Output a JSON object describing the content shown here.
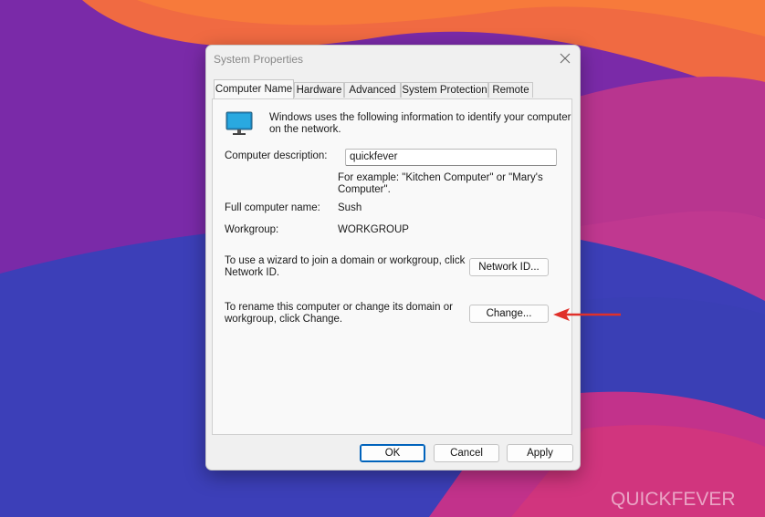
{
  "dialog": {
    "title": "System Properties",
    "tabs": [
      {
        "label": "Computer Name",
        "active": true
      },
      {
        "label": "Hardware",
        "active": false
      },
      {
        "label": "Advanced",
        "active": false
      },
      {
        "label": "System Protection",
        "active": false
      },
      {
        "label": "Remote",
        "active": false
      }
    ],
    "intro_text_line1": "Windows uses the following information to identify your computer",
    "intro_text_line2": "on the network.",
    "computer_description": {
      "label": "Computer description:",
      "value": "quickfever",
      "hint_line1": "For example: \"Kitchen Computer\" or \"Mary's",
      "hint_line2": "Computer\"."
    },
    "full_computer_name": {
      "label": "Full computer name:",
      "value": "Sush"
    },
    "workgroup": {
      "label": "Workgroup:",
      "value": "WORKGROUP"
    },
    "network_id": {
      "text_line1": "To use a wizard to join a domain or workgroup, click",
      "text_line2": "Network ID.",
      "button_label": "Network ID..."
    },
    "rename": {
      "text_line1": "To rename this computer or change its domain or",
      "text_line2": "workgroup, click Change.",
      "button_label": "Change..."
    },
    "buttons": {
      "ok": "OK",
      "cancel": "Cancel",
      "apply": "Apply"
    }
  },
  "watermark": {
    "text": "QUICKFEVER"
  },
  "colors": {
    "annotation_arrow": "#e0302a",
    "accent": "#0067c0"
  }
}
